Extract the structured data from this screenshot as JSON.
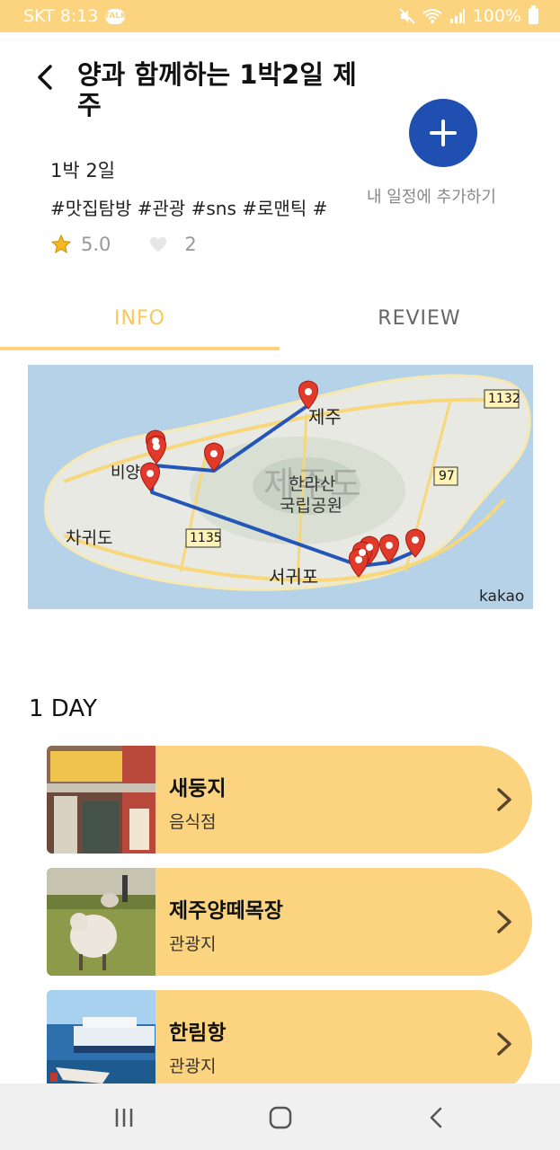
{
  "status_bar": {
    "carrier_time": "SKT 8:13",
    "battery": "100%",
    "talk_badge": "TALK"
  },
  "header": {
    "title": "양과 함께하는 1박2일 제주"
  },
  "trip": {
    "duration": "1박 2일",
    "tags": "#맛집탐방 #관광 #sns #로맨틱 #",
    "rating": "5.0",
    "likes": "2"
  },
  "add_button": {
    "label": "내 일정에 추가하기"
  },
  "tabs": [
    {
      "label": "INFO"
    },
    {
      "label": "REVIEW"
    }
  ],
  "map": {
    "labels": {
      "jeju": "제주",
      "island": "제주도",
      "hallasan": "한라산",
      "park": "국립공원",
      "seogwipo": "서귀포",
      "chagwido": "차귀도",
      "biyang": "비양",
      "kakao": "kakao"
    },
    "route_numbers": {
      "r1132": "1132",
      "r97": "97",
      "r1135": "1135"
    }
  },
  "day": {
    "title": "1 DAY"
  },
  "places": [
    {
      "name": "새둥지",
      "category": "음식점"
    },
    {
      "name": "제주양떼목장",
      "category": "관광지"
    },
    {
      "name": "한림항",
      "category": "관광지"
    }
  ],
  "colors": {
    "accent": "#fcd37e",
    "add_button": "#1f4fb0",
    "route": "#2456b8",
    "marker": "#e23a2a"
  }
}
